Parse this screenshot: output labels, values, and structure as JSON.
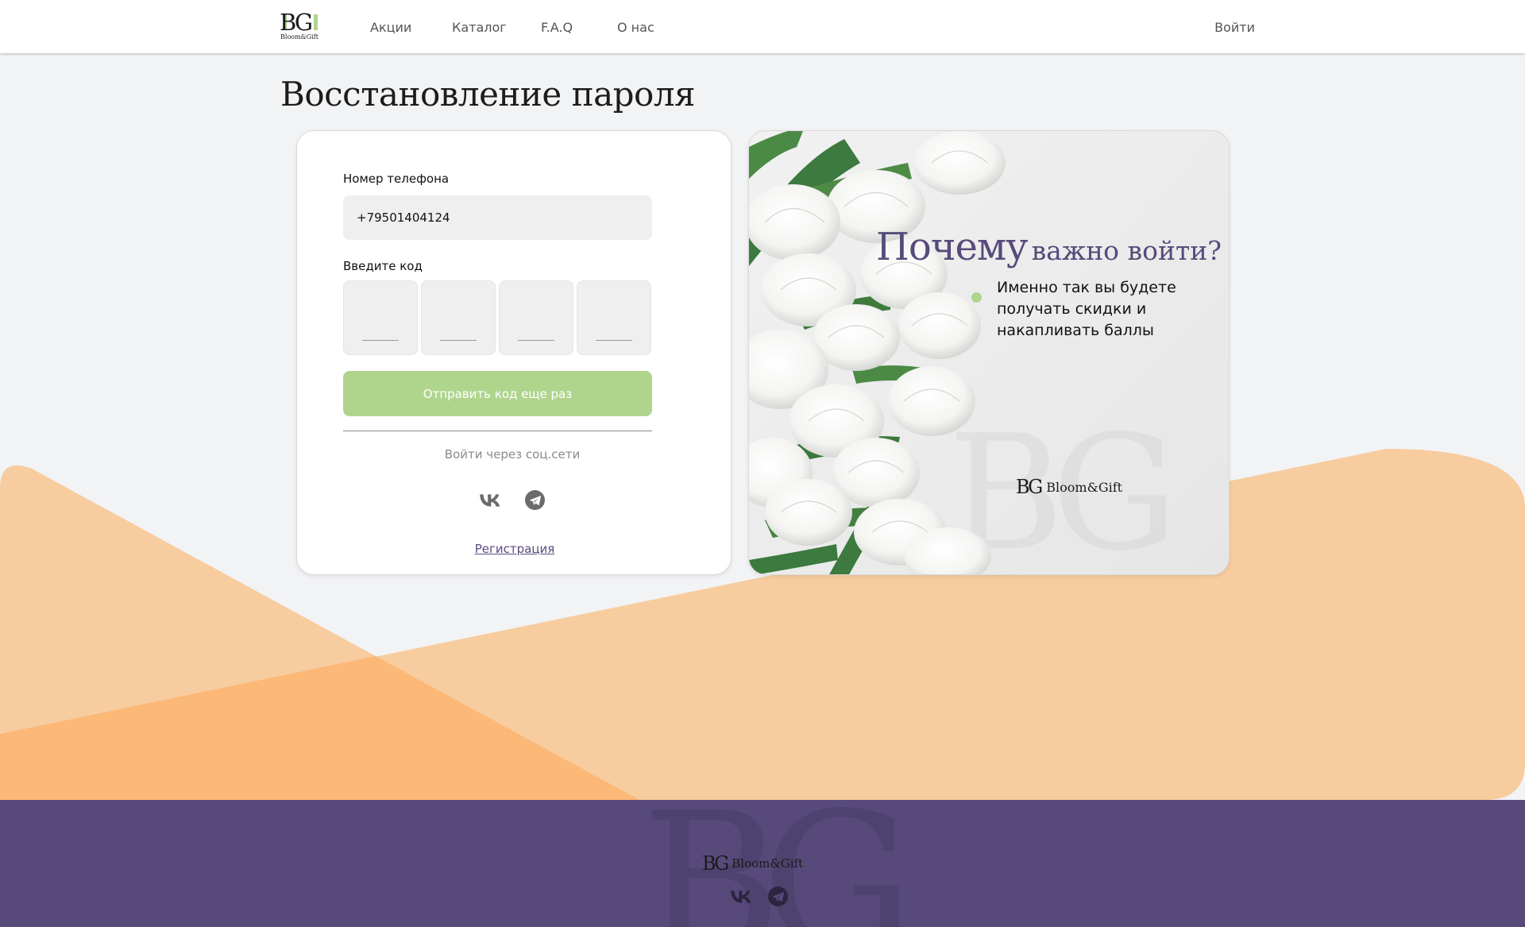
{
  "header": {
    "logo_mark": "BG",
    "logo_wordmark": "Bloom&Gift",
    "nav": [
      {
        "label": "Акции"
      },
      {
        "label": "Каталог"
      },
      {
        "label": "F.A.Q"
      },
      {
        "label": "О нас"
      }
    ],
    "login_label": "Войти"
  },
  "page": {
    "title": "Восстановление пароля"
  },
  "form": {
    "phone_label": "Номер телефона",
    "phone_value": "+79501404124",
    "code_label": "Введите код",
    "code_digits": [
      "",
      "",
      "",
      ""
    ],
    "resend_label": "Отправить код еще раз",
    "social_label": "Войти через соц.сети",
    "social_icons": [
      "vk-icon",
      "telegram-icon"
    ],
    "register_label": "Регистрация"
  },
  "promo": {
    "title_big": "Почему",
    "title_small": "важно войти?",
    "text": "Именно так вы будете получать скидки и накапливать баллы",
    "logo_mark": "BG",
    "logo_wordmark": "Bloom&Gift"
  },
  "footer": {
    "logo_mark": "BG",
    "logo_wordmark": "Bloom&Gift",
    "social_icons": [
      "vk-icon",
      "telegram-icon"
    ]
  },
  "colors": {
    "accent_green": "#afd58d",
    "brand_purple": "#574a7b",
    "peach": "#f7cc9f",
    "orange": "#fcb877",
    "background": "#f2f3f5"
  }
}
